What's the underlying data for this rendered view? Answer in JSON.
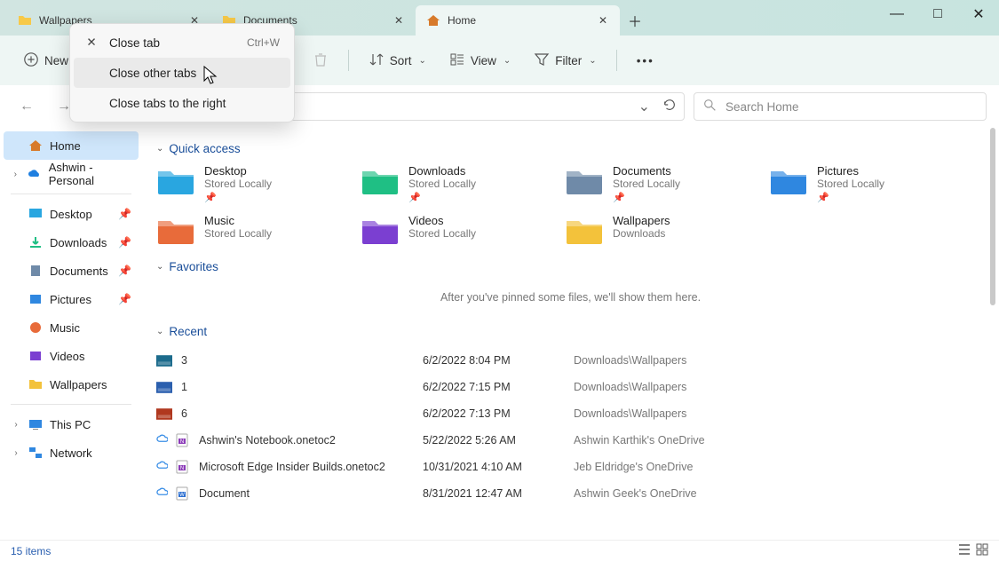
{
  "tabs": [
    {
      "label": "Wallpapers",
      "active": false
    },
    {
      "label": "Documents",
      "active": false
    },
    {
      "label": "Home",
      "active": true
    }
  ],
  "win": {
    "min": "—",
    "max": "□",
    "close": "✕"
  },
  "toolbar": {
    "new": "New",
    "sort": "Sort",
    "view": "View",
    "filter": "Filter"
  },
  "search": {
    "placeholder": "Search Home"
  },
  "sidebar": {
    "home": "Home",
    "onedrive": "Ashwin - Personal",
    "quick": [
      {
        "label": "Desktop"
      },
      {
        "label": "Downloads"
      },
      {
        "label": "Documents"
      },
      {
        "label": "Pictures"
      },
      {
        "label": "Music"
      },
      {
        "label": "Videos"
      },
      {
        "label": "Wallpapers"
      }
    ],
    "thispc": "This PC",
    "network": "Network"
  },
  "sections": {
    "quick": "Quick access",
    "favorites": "Favorites",
    "recent": "Recent"
  },
  "quick_access": [
    {
      "name": "Desktop",
      "sub": "Stored Locally",
      "pinned": true,
      "color": "#29a6e0"
    },
    {
      "name": "Downloads",
      "sub": "Stored Locally",
      "pinned": true,
      "color": "#1fbf84"
    },
    {
      "name": "Documents",
      "sub": "Stored Locally",
      "pinned": true,
      "color": "#6f8aa8"
    },
    {
      "name": "Pictures",
      "sub": "Stored Locally",
      "pinned": true,
      "color": "#2f87e0"
    },
    {
      "name": "Music",
      "sub": "Stored Locally",
      "pinned": false,
      "color": "#e86b3a"
    },
    {
      "name": "Videos",
      "sub": "Stored Locally",
      "pinned": false,
      "color": "#7b3fd1"
    },
    {
      "name": "Wallpapers",
      "sub": "Downloads",
      "pinned": false,
      "color": "#f3c23b"
    }
  ],
  "favorites_empty": "After you've pinned some files, we'll show them here.",
  "recent": [
    {
      "name": "3",
      "date": "6/2/2022 8:04 PM",
      "path": "Downloads\\Wallpapers",
      "cloud": false,
      "thumb": "#1c6b8c"
    },
    {
      "name": "1",
      "date": "6/2/2022 7:15 PM",
      "path": "Downloads\\Wallpapers",
      "cloud": false,
      "thumb": "#2b5fae"
    },
    {
      "name": "6",
      "date": "6/2/2022 7:13 PM",
      "path": "Downloads\\Wallpapers",
      "cloud": false,
      "thumb": "#b0381f"
    },
    {
      "name": "Ashwin's Notebook.onetoc2",
      "date": "5/22/2022 5:26 AM",
      "path": "Ashwin Karthik's OneDrive",
      "cloud": true,
      "app": "N"
    },
    {
      "name": "Microsoft Edge Insider Builds.onetoc2",
      "date": "10/31/2021 4:10 AM",
      "path": "Jeb Eldridge's OneDrive",
      "cloud": true,
      "app": "N"
    },
    {
      "name": "Document",
      "date": "8/31/2021 12:47 AM",
      "path": "Ashwin Geek's OneDrive",
      "cloud": true,
      "app": "W"
    }
  ],
  "status": {
    "items": "15 items"
  },
  "ctx": {
    "close": "Close tab",
    "close_sc": "Ctrl+W",
    "close_other": "Close other tabs",
    "close_right": "Close tabs to the right"
  }
}
